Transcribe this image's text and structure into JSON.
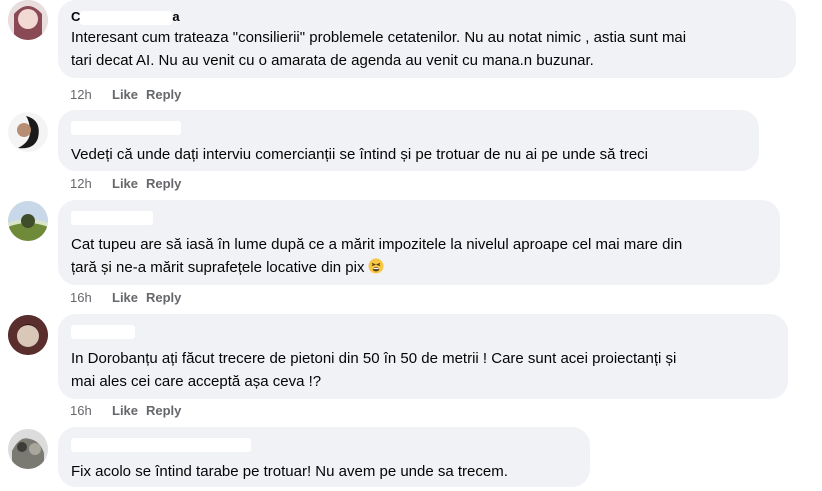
{
  "comments": [
    {
      "author_visible_start": "C",
      "author_visible_end": "a",
      "text": "Interesant cum trateaza \"consilierii\" problemele cetatenilor. Nu au notat nimic , astia sunt mai\ntari decat AI. Nu au venit cu o amarata de agenda au venit cu mana.n buzunar.",
      "time": "12h",
      "like": "Like",
      "reply": "Reply"
    },
    {
      "author_visible_start": "",
      "author_visible_end": "",
      "text": "Vedeți că unde dați interviu comercianții se întind și pe trotuar de nu ai pe unde să treci",
      "time": "12h",
      "like": "Like",
      "reply": "Reply"
    },
    {
      "author_visible_start": "",
      "author_visible_end": "",
      "text": "Cat tupeu are să iasă în lume după ce a mărit impozitele la nivelul aproape cel mai mare din\nțară și ne-a mărit suprafețele locative din pix",
      "emoji": "tired-face-emoji",
      "time": "16h",
      "like": "Like",
      "reply": "Reply"
    },
    {
      "author_visible_start": "",
      "author_visible_end": "",
      "text": "In Dorobanțu ați făcut trecere de pietoni din 50 în 50 de metrii ! Care sunt acei proiectanți și\nmai ales cei care acceptă așa ceva !?",
      "time": "16h",
      "like": "Like",
      "reply": "Reply"
    },
    {
      "author_visible_start": "",
      "author_visible_end": "",
      "text": "Fix acolo se întind tarabe pe trotuar! Nu avem pe unde sa trecem."
    }
  ],
  "colors": {
    "bubble": "#f0f2f5",
    "meta": "#65676b",
    "text": "#050505"
  }
}
